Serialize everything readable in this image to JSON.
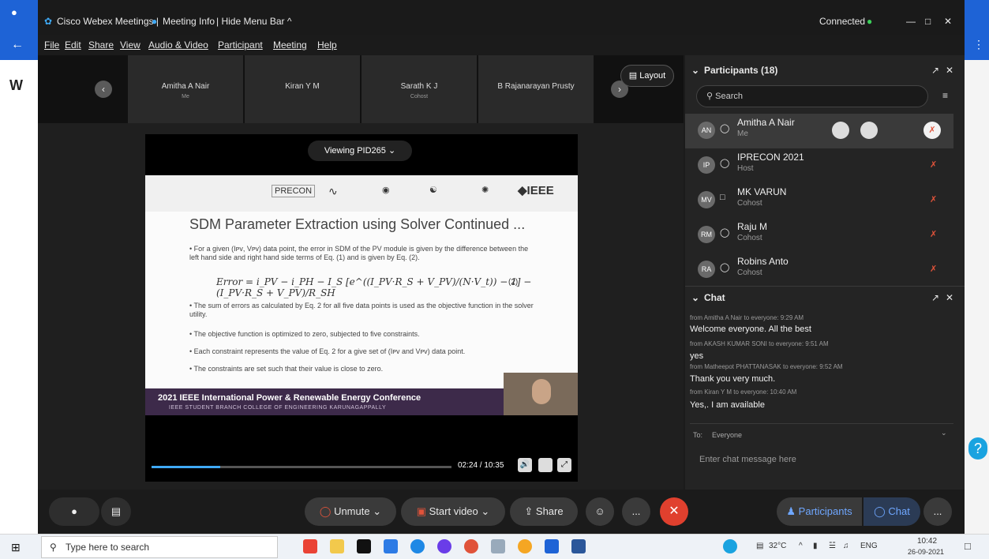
{
  "window": {
    "app_title": "Cisco Webex Meetings |",
    "meeting_info": "Meeting Info",
    "hide_menu": "| Hide Menu Bar ^",
    "connected": "Connected",
    "controls": {
      "min": "—",
      "max": "□",
      "close": "✕"
    }
  },
  "menu": [
    "File",
    "Edit",
    "Share",
    "View",
    "Audio & Video",
    "Participant",
    "Meeting",
    "Help"
  ],
  "thumbnails": [
    {
      "name": "Amitha A Nair",
      "role": "Me"
    },
    {
      "name": "Kiran Y M",
      "role": ""
    },
    {
      "name": "Sarath K J",
      "role": "Cohost"
    },
    {
      "name": "B Rajanarayan Prusty",
      "role": ""
    }
  ],
  "layout_label": "Layout",
  "viewing_label": "Viewing PID265",
  "slide": {
    "logos": [
      "PRECON",
      "IEEE"
    ],
    "title": "SDM Parameter Extraction using Solver Continued ...",
    "bullet1": "• For a given (Iᴘᴠ, Vᴘᴠ) data point, the error in SDM of the PV module is given by the difference between the left hand side and right hand side terms of Eq. (1) and is given by Eq. (2).",
    "equation": "Error = i_PV − i_PH − I_S [e^((I_PV·R_S + V_PV)/(N·V_t)) − 1] − (I_PV·R_S + V_PV)/R_SH",
    "eq_num": "(2)",
    "bullet2": "• The sum of errors as calculated by Eq. 2 for all five data points is used as the objective function in the solver utility.",
    "bullet3": "• The objective function is optimized to zero, subjected to five constraints.",
    "bullet4": "• Each constraint represents the value of Eq. 2 for a give set of (Iᴘᴠ and Vᴘᴠ) data point.",
    "bullet5": "• The constraints are set such that their value is close to zero.",
    "footer_title": "2021 IEEE International Power & Renewable Energy Conference",
    "footer_sub": "IEEE STUDENT BRANCH COLLEGE OF ENGINEERING KARUNAGAPPALLY"
  },
  "playback": {
    "time": "02:24 / 10:35",
    "progress": 0.23
  },
  "toolbar": {
    "unmute": "Unmute",
    "start_video": "Start video",
    "share": "Share",
    "participants": "Participants",
    "chat": "Chat",
    "more": "..."
  },
  "participants_panel": {
    "title": "Participants (18)",
    "search_placeholder": "Search",
    "list": [
      {
        "initials": "AN",
        "name": "Amitha A Nair",
        "role": "Me"
      },
      {
        "initials": "IP",
        "name": "IPRECON 2021",
        "role": "Host"
      },
      {
        "initials": "MV",
        "name": "MK VARUN",
        "role": "Cohost"
      },
      {
        "initials": "RM",
        "name": "Raju M",
        "role": "Cohost"
      },
      {
        "initials": "RA",
        "name": "Robins Anto",
        "role": "Cohost"
      }
    ]
  },
  "chat_panel": {
    "title": "Chat",
    "messages": [
      {
        "meta": "from Amitha A Nair to everyone:   9:29 AM",
        "text": "Welcome everyone. All the best"
      },
      {
        "meta": "from AKASH KUMAR SONI to everyone:   9:51 AM",
        "text": "yes"
      },
      {
        "meta": "from Matheepot PHATTANASAK to everyone:   9:52 AM",
        "text": "Thank you very much."
      },
      {
        "meta": "from Kiran Y M to everyone:   10:40 AM",
        "text": "Yes,. I am available"
      }
    ],
    "to_label": "To:",
    "to_value": "Everyone",
    "input_placeholder": "Enter chat message here"
  },
  "taskbar": {
    "search": "Type here to search",
    "weather": "32°C",
    "lang": "ENG",
    "time": "10:42",
    "date": "26-09-2021"
  },
  "colors": {
    "accent": "#1e63d6",
    "end_call": "#e0402e",
    "mic_off": "#e0533a",
    "footer": "#3d2a4a"
  }
}
